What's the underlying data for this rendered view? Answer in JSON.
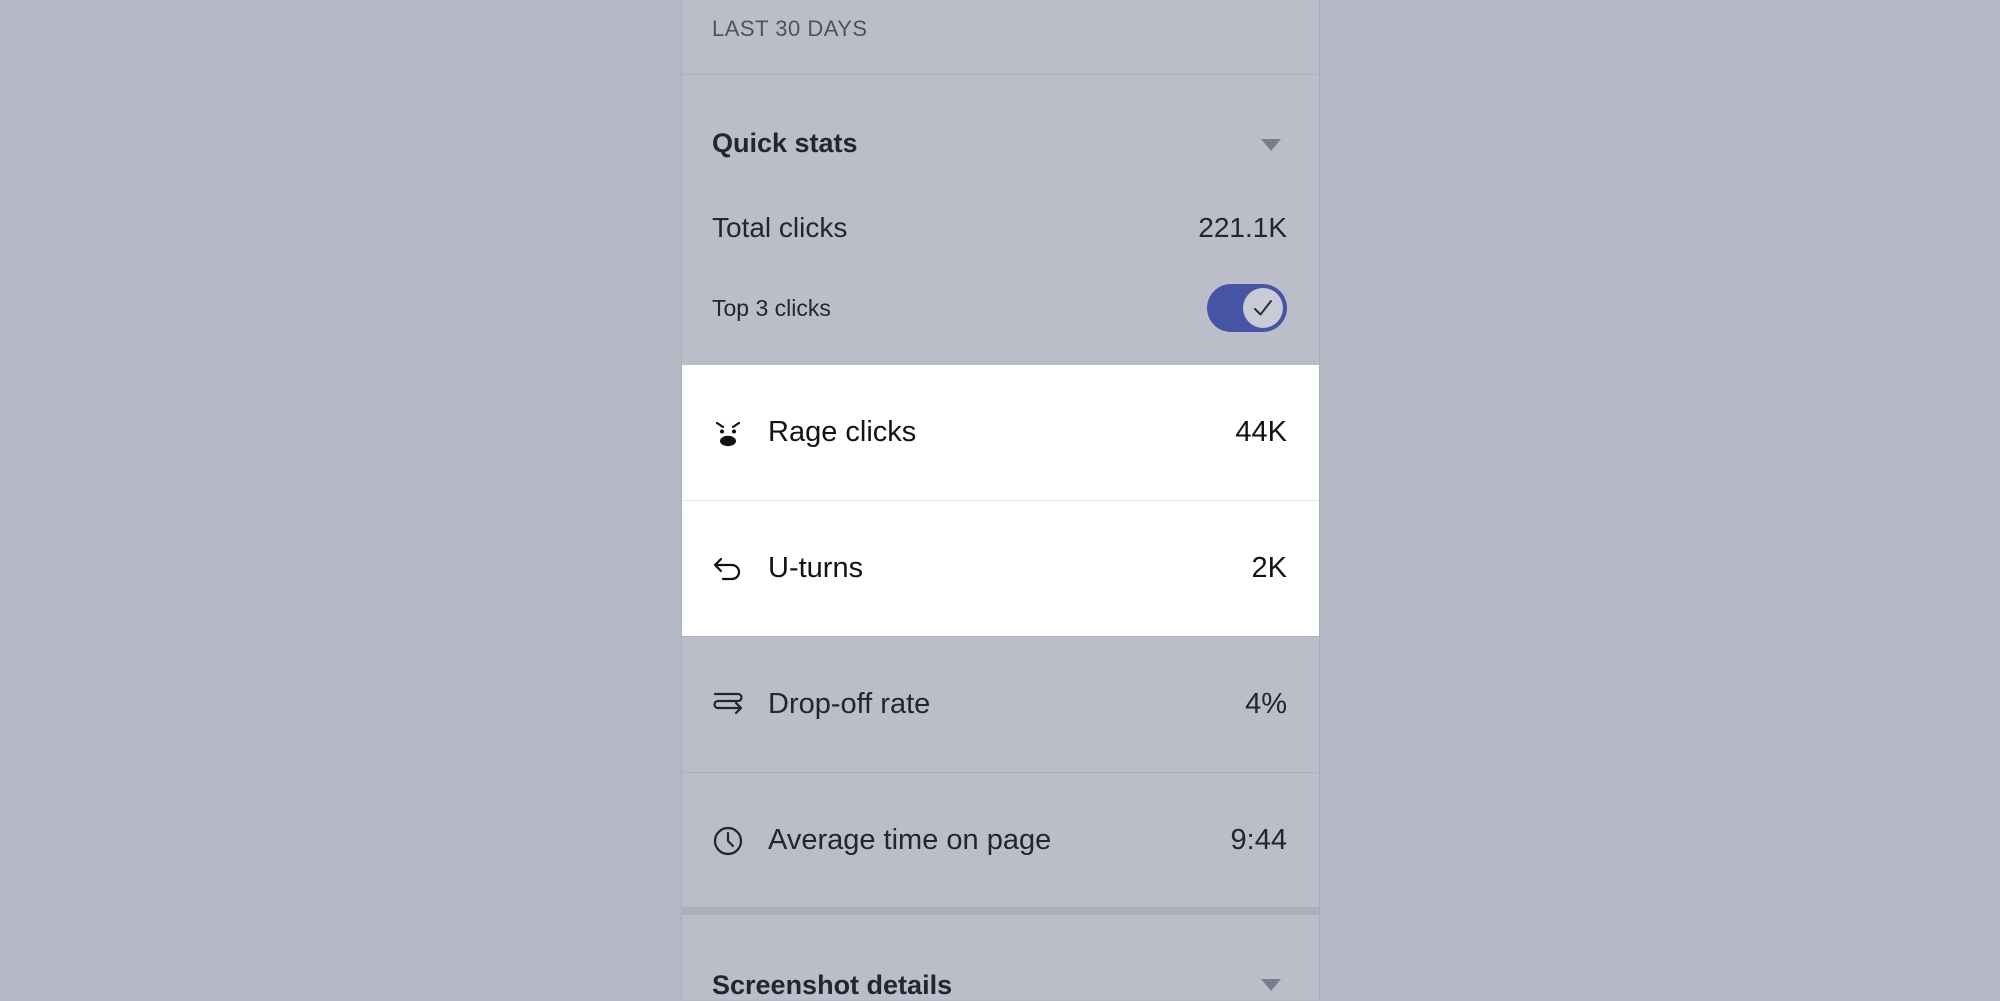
{
  "header": {
    "period_label": "LAST 30 DAYS"
  },
  "quick_stats": {
    "title": "Quick stats",
    "total_clicks_label": "Total clicks",
    "total_clicks_value": "221.1K",
    "top3_label": "Top 3 clicks",
    "top3_enabled": true,
    "metrics": [
      {
        "label": "Rage clicks",
        "value": "44K",
        "icon": "rage-face-icon",
        "highlighted": true
      },
      {
        "label": "U-turns",
        "value": "2K",
        "icon": "u-turn-arrow-icon",
        "highlighted": true
      },
      {
        "label": "Drop-off rate",
        "value": "4%",
        "icon": "drop-off-icon",
        "highlighted": false
      },
      {
        "label": "Average time on page",
        "value": "9:44",
        "icon": "clock-icon",
        "highlighted": false
      }
    ]
  },
  "screenshot_details": {
    "title": "Screenshot details"
  },
  "colors": {
    "backdrop": "#b5b8c5",
    "panel": "#bbbec8",
    "toggle_on": "#4554a4",
    "highlight": "#ffffff"
  }
}
